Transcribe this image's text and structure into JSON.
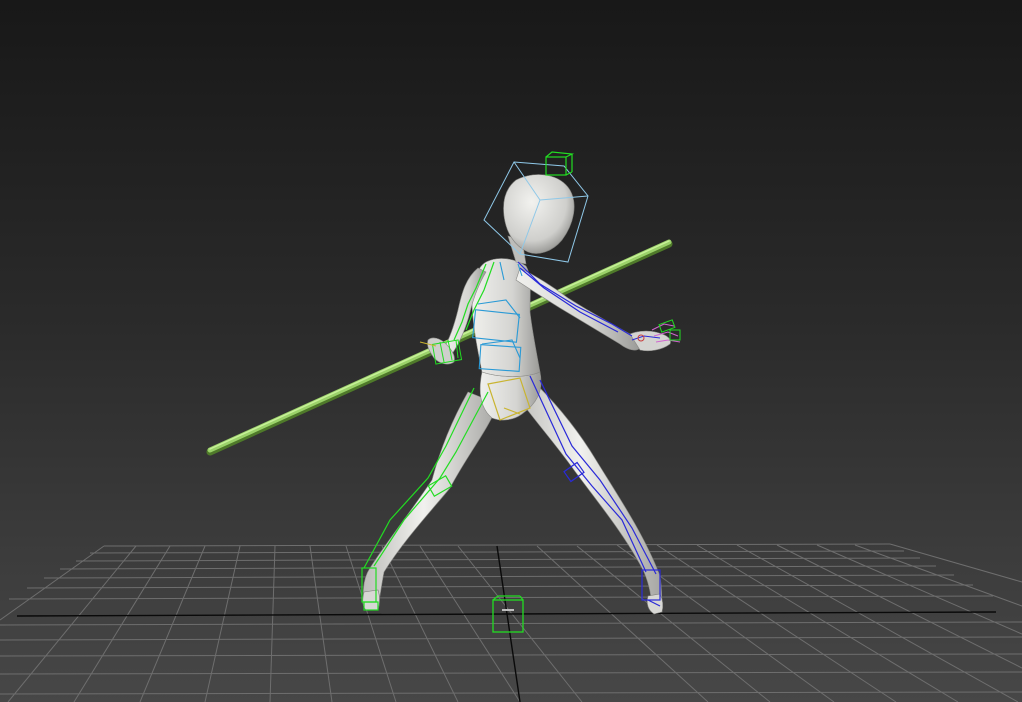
{
  "viewport": {
    "mode": "perspective",
    "shading": "smooth",
    "grid": true
  },
  "colors": {
    "background_top": "#181818",
    "background_bottom": "#474747",
    "grid_line": "#6e6e6e",
    "grid_axis": "#0a0a0a",
    "body": "#d9d9d6",
    "staff": "#9bd26a",
    "rig_green": "#22dd22",
    "rig_blue": "#2a2ad8",
    "rig_cyan": "#2a9ad6",
    "rig_yellow": "#c9b430",
    "rig_head": "#8fc8e8",
    "hand_magenta": "#d066d0"
  },
  "icons": {
    "root_controller": "root-control-box-icon",
    "head_controller": "head-control-box-icon"
  }
}
